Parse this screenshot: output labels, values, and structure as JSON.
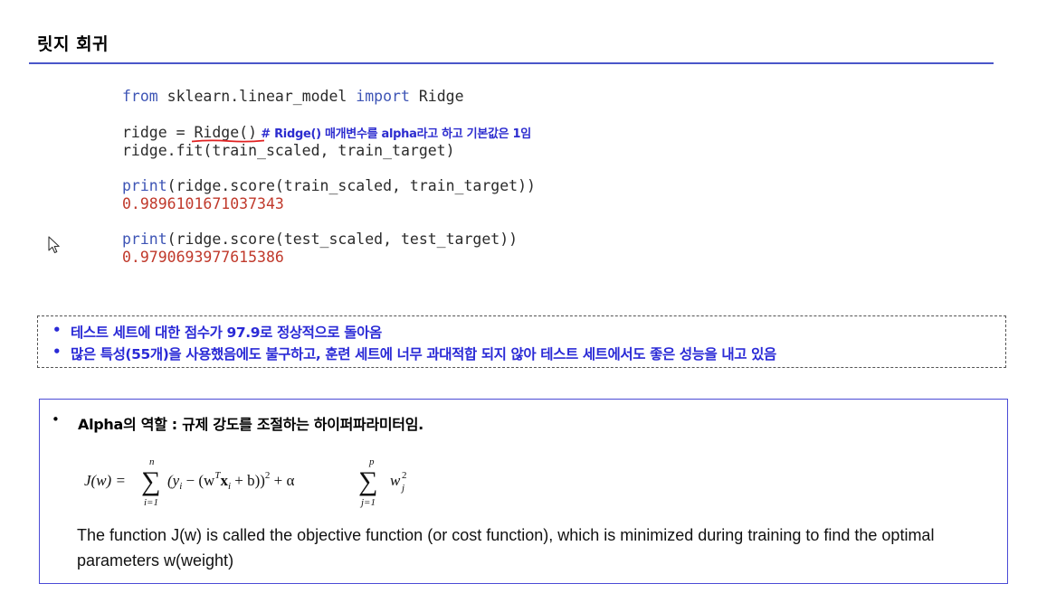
{
  "slide": {
    "title": "릿지 회귀"
  },
  "code": {
    "import_from": "from",
    "import_module": " sklearn.linear_model ",
    "import_kw": "import",
    "import_name": " Ridge",
    "assign_prefix": "ridge = ",
    "ridge_call": "Ridge()",
    "comment": " # Ridge() 매개변수를 alpha라고 하고 기본값은 1임",
    "fit_line": "ridge.fit(train_scaled, train_target)",
    "print_kw": "print",
    "print_train_args": "(ridge.score(train_scaled, train_target))",
    "train_score": "0.9896101671037343",
    "print_test_args": "(ridge.score(test_scaled, test_target))",
    "test_score": "0.9790693977615386"
  },
  "notes": {
    "bullet": "•",
    "items": [
      "테스트 세트에 대한 점수가 97.9로  정상적으로 돌아옴",
      "많은 특성(55개)을 사용했음에도 불구하고, 훈련 세트에 너무 과대적합 되지 않아 테스트 세트에서도 좋은 성능을 내고 있음"
    ]
  },
  "alpha": {
    "bullet": "•",
    "heading": "Alpha의 역할 : 규제 강도를 조절하는 하이퍼파라미터임.",
    "description": "The function J(w) is called the objective function (or cost function), which is minimized during training to find the optimal parameters w(weight)"
  },
  "formula": {
    "lhs": "J(w) =",
    "sum1_top": "n",
    "sum1_bottom": "i=1",
    "term1": "(y",
    "term1_sub": "i",
    "term2": " − (w",
    "term2_sup": "T",
    "term3": "x",
    "term3_sub": "i",
    "term4": " + b))",
    "term4_sup": "2",
    "term5": " + α",
    "sum2_top": "p",
    "sum2_bottom": "j=1",
    "w": "w",
    "w_sup": "2",
    "w_sub": "j",
    "sigma": "∑"
  },
  "colors": {
    "accent_rule": "#4a56c9",
    "keyword": "#3d54b5",
    "output": "#c0392b",
    "note_text": "#2a2ad6",
    "box_border": "#4b4bd6",
    "underline": "#e02020"
  },
  "icons": {
    "cursor": "mouse-pointer-icon"
  }
}
